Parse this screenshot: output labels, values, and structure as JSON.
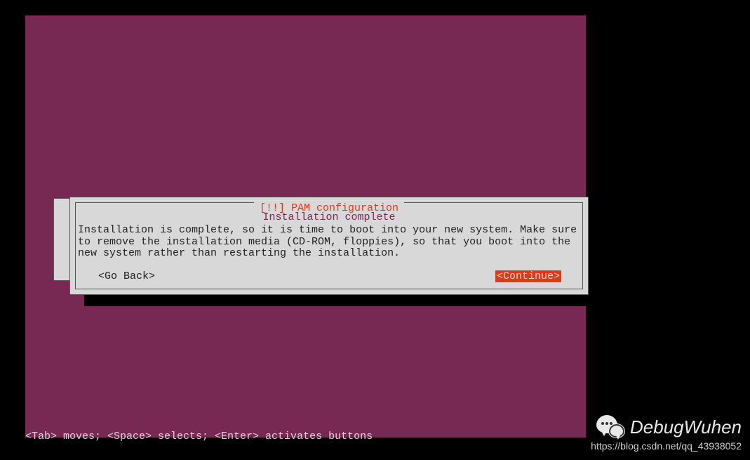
{
  "dialog": {
    "title": "[!!] PAM configuration",
    "subtitle": "Installation complete",
    "body": "Installation is complete, so it is time to boot into your new system. Make sure to remove the installation media (CD-ROM, floppies), so that you boot into the new system rather than restarting the installation.",
    "go_back_label": "<Go Back>",
    "continue_label": "<Continue>"
  },
  "footer": {
    "hint": "<Tab> moves; <Space> selects; <Enter> activates buttons"
  },
  "watermark": {
    "name": "DebugWuhen",
    "url": "https://blog.csdn.net/qq_43938052"
  }
}
